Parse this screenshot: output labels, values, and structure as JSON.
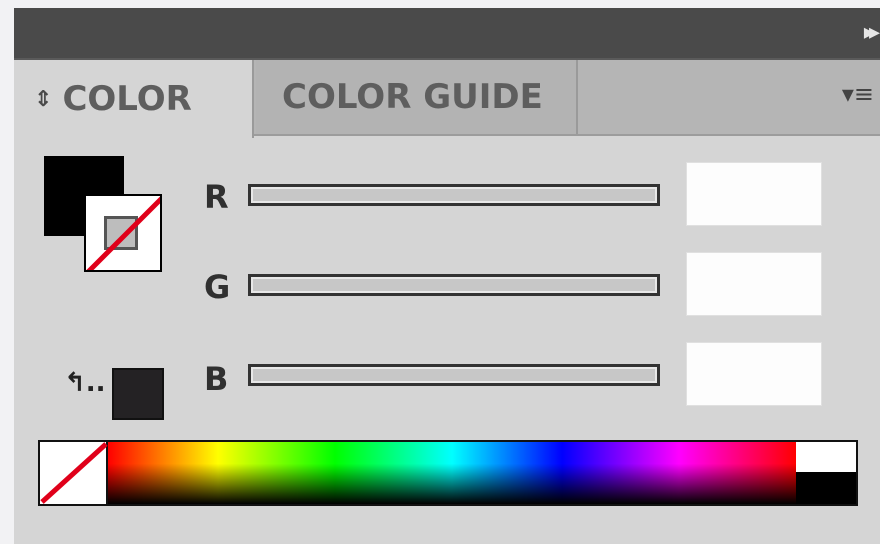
{
  "panel": {
    "tabs": [
      {
        "label": "COLOR",
        "active": true
      },
      {
        "label": "COLOR GUIDE",
        "active": false
      }
    ],
    "icons": {
      "collapse": "double-arrow-right-icon",
      "menu": "panel-menu-icon",
      "tab_arrows": "up-down-arrows-icon",
      "swap": "swap-arrow-icon"
    }
  },
  "swatches": {
    "fill_color": "#000000",
    "stroke": "none",
    "last_color": "#242224"
  },
  "channels": [
    {
      "label": "R",
      "value": ""
    },
    {
      "label": "G",
      "value": ""
    },
    {
      "label": "B",
      "value": ""
    }
  ],
  "spectrum": {
    "none_indicator_color": "#e0001a",
    "white": "#ffffff",
    "black": "#000000"
  }
}
